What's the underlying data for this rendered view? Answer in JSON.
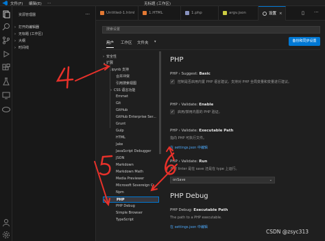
{
  "titlebar": {
    "menus": [
      "文件(F)",
      "编辑(E)",
      "…"
    ],
    "title": "无标题 (工作区)"
  },
  "sidebar": {
    "header": "资源管理器",
    "items": [
      {
        "label": "打开的编辑器"
      },
      {
        "label": "无标题 (工作区)"
      },
      {
        "label": "大纲"
      },
      {
        "label": "时间线"
      }
    ]
  },
  "tabs": [
    {
      "label": "Untitled-1.html",
      "icon_color": "#e37933"
    },
    {
      "label": "1.HTML",
      "icon_color": "#e37933"
    },
    {
      "label": "1.php",
      "icon_color": "#8892bf"
    },
    {
      "label": "argv.json",
      "icon_color": "#cbcb41"
    },
    {
      "label": "设置",
      "icon_color": "#cccccc",
      "active": true
    }
  ],
  "settings": {
    "search_placeholder": "搜索设置",
    "scope_tabs": [
      "用户",
      "工作区",
      "文件夹"
    ],
    "sync_button": "备份和同步设置",
    "toc": {
      "items": [
        {
          "label": "安全性",
          "chevron": "›"
        },
        {
          "label": "扩展",
          "chevron": "⌄"
        },
        {
          "label": ".ipynb 支持"
        },
        {
          "label": "合并冲突"
        },
        {
          "label": "引用搜索视图"
        },
        {
          "label": "CSS 语言功能",
          "chevron": "›"
        },
        {
          "label": "Emmet"
        },
        {
          "label": "Git"
        },
        {
          "label": "GitHub"
        },
        {
          "label": "GitHub Enterprise Ser..."
        },
        {
          "label": "Grunt"
        },
        {
          "label": "Gulp"
        },
        {
          "label": "HTML"
        },
        {
          "label": "Jake"
        },
        {
          "label": "JavaScript Debugger"
        },
        {
          "label": "JSON"
        },
        {
          "label": "Markdown"
        },
        {
          "label": "Markdown Math"
        },
        {
          "label": "Media Previewer"
        },
        {
          "label": "Microsoft Sovereign C..."
        },
        {
          "label": "Npm"
        },
        {
          "label": "PHP",
          "selected": true
        },
        {
          "label": "PHP Debug"
        },
        {
          "label": "Simple Browser"
        },
        {
          "label": "TypeScript"
        }
      ]
    },
    "content": {
      "section1": "PHP",
      "suggest": {
        "name": "PHP › Suggest: ",
        "name_bold": "Basic",
        "desc": "控制是否启用内置 PHP 语言建议。支持对 PHP 全局变量和变量进行建议。",
        "checked": true
      },
      "validate_enable": {
        "name": "PHP › Validate: ",
        "name_bold": "Enable",
        "desc": "启用/禁用内置的 PHP 验证。",
        "checked": true
      },
      "executable": {
        "name": "PHP › Validate: ",
        "name_bold": "Executable Path",
        "desc": "指向 PHP 可执行文件。",
        "link": "在 settings.json 中编辑"
      },
      "run": {
        "name": "PHP › Validate: ",
        "name_bold": "Run",
        "desc": "不管 linter 是在 save 还是在 type 上运行。",
        "value": "onSave"
      },
      "section2": "PHP Debug",
      "debug_exec": {
        "name": "PHP Debug: ",
        "name_bold": "Executable Path",
        "desc": "The path to a PHP executable.",
        "link": "在 settings.json 中编辑"
      }
    }
  },
  "annotations": [
    "4",
    "5",
    "6"
  ],
  "watermark": "CSDN @zsyc313"
}
